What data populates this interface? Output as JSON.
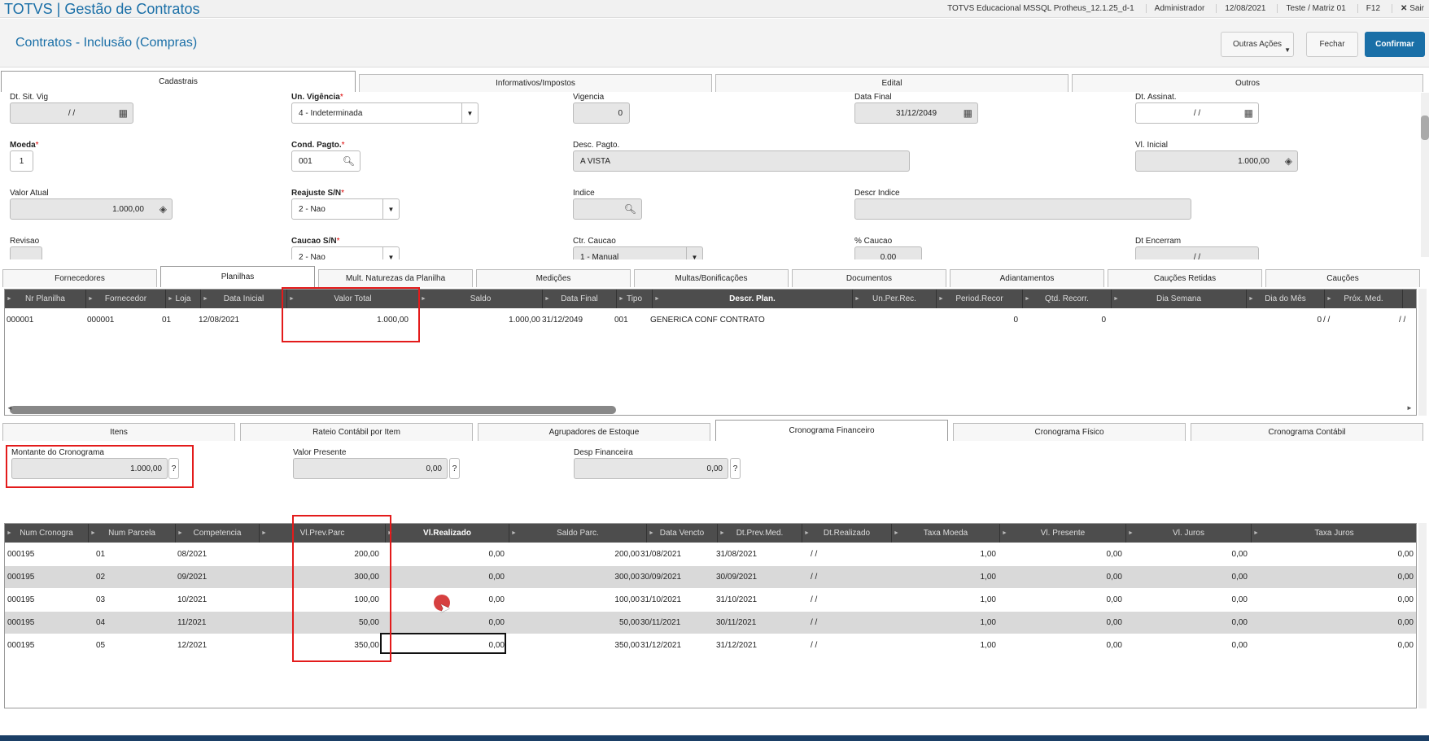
{
  "topbar": {
    "brand": "TOTVS | Gestão de Contratos",
    "env": "TOTVS Educacional MSSQL Protheus_12.1.25_d-1",
    "user": "Administrador",
    "date": "12/08/2021",
    "branch": "Teste / Matriz 01",
    "shortcut": "F12",
    "exit": "Sair"
  },
  "header": {
    "title": "Contratos - Inclusão (Compras)",
    "actions_label": "Outras Ações",
    "close_label": "Fechar",
    "confirm_label": "Confirmar"
  },
  "main_tabs": [
    "Cadastrais",
    "Informativos/Impostos",
    "Edital",
    "Outros"
  ],
  "form": {
    "dt_sit_vig": {
      "label": "Dt. Sit. Vig",
      "value": " / /"
    },
    "un_vigencia": {
      "label": "Un. Vigência",
      "value": "4 - Indeterminada"
    },
    "vigencia": {
      "label": "Vigencia",
      "value": "0"
    },
    "data_final": {
      "label": "Data Final",
      "value": "31/12/2049"
    },
    "dt_assinat": {
      "label": "Dt. Assinat.",
      "value": " / /"
    },
    "moeda": {
      "label": "Moeda",
      "value": "1"
    },
    "cond_pagto": {
      "label": "Cond. Pagto.",
      "value": "001"
    },
    "desc_pagto": {
      "label": "Desc. Pagto.",
      "value": "A VISTA"
    },
    "vl_inicial": {
      "label": "Vl. Inicial",
      "value": "1.000,00"
    },
    "valor_atual": {
      "label": "Valor Atual",
      "value": "1.000,00"
    },
    "reajuste": {
      "label": "Reajuste S/N",
      "value": "2 - Nao"
    },
    "indice": {
      "label": "Indice",
      "value": ""
    },
    "descr_indice": {
      "label": "Descr Indice",
      "value": ""
    },
    "revisao": {
      "label": "Revisao",
      "value": ""
    },
    "caucao": {
      "label": "Caucao S/N",
      "value": "2 - Nao"
    },
    "ctr_caucao": {
      "label": "Ctr. Caucao",
      "value": "1 - Manual"
    },
    "pct_caucao": {
      "label": "% Caucao",
      "value": "0,00"
    },
    "dt_encerram": {
      "label": "Dt Encerram",
      "value": " / /"
    }
  },
  "sub_tabs": [
    "Fornecedores",
    "Planilhas",
    "Mult. Naturezas da Planilha",
    "Medições",
    "Multas/Bonificações",
    "Documentos",
    "Adiantamentos",
    "Cauções Retidas",
    "Cauções"
  ],
  "planilhas_grid": {
    "columns": [
      "Nr Planilha",
      "Fornecedor",
      "Loja",
      "Data Inicial",
      "Valor Total",
      "Saldo",
      "Data Final",
      "Tipo",
      "Descr. Plan.",
      "Un.Per.Rec.",
      "Period.Recor",
      "Qtd. Recorr.",
      "Dia Semana",
      "Dia do Mês",
      "Próx. Med."
    ],
    "rows": [
      [
        "000001",
        "000001",
        "01",
        "12/08/2021",
        "1.000,00",
        "1.000,00",
        "31/12/2049",
        "001",
        "GENERICA CONF CONTRATO",
        "",
        "0",
        "0",
        "",
        "0",
        " / /",
        " / /"
      ]
    ]
  },
  "lower_tabs": [
    "Itens",
    "Rateio Contábil por Item",
    "Agrupadores de Estoque",
    "Cronograma Financeiro",
    "Cronograma Físico",
    "Cronograma Contábil"
  ],
  "cronograma": {
    "montante": {
      "label": "Montante do Cronograma",
      "value": "1.000,00"
    },
    "valor_presente": {
      "label": "Valor Presente",
      "value": "0,00"
    },
    "desp_financeira": {
      "label": "Desp Financeira",
      "value": "0,00"
    },
    "help": "?"
  },
  "cronograma_grid": {
    "columns": [
      "Num Cronogra",
      "Num Parcela",
      "Competencia",
      "Vl.Prev.Parc",
      "Vl.Realizado",
      "Saldo Parc.",
      "Data Vencto",
      "Dt.Prev.Med.",
      "Dt.Realizado",
      "Taxa Moeda",
      "Vl. Presente",
      "Vl. Juros",
      "Taxa Juros"
    ],
    "rows": [
      [
        "000195",
        "01",
        "08/2021",
        "200,00",
        "0,00",
        "200,00",
        "31/08/2021",
        "31/08/2021",
        " / /",
        "1,00",
        "0,00",
        "0,00",
        "0,00"
      ],
      [
        "000195",
        "02",
        "09/2021",
        "300,00",
        "0,00",
        "300,00",
        "30/09/2021",
        "30/09/2021",
        " / /",
        "1,00",
        "0,00",
        "0,00",
        "0,00"
      ],
      [
        "000195",
        "03",
        "10/2021",
        "100,00",
        "0,00",
        "100,00",
        "31/10/2021",
        "31/10/2021",
        " / /",
        "1,00",
        "0,00",
        "0,00",
        "0,00"
      ],
      [
        "000195",
        "04",
        "11/2021",
        "50,00",
        "0,00",
        "50,00",
        "30/11/2021",
        "30/11/2021",
        " / /",
        "1,00",
        "0,00",
        "0,00",
        "0,00"
      ],
      [
        "000195",
        "05",
        "12/2021",
        "350,00",
        "0,00",
        "350,00",
        "31/12/2021",
        "31/12/2021",
        " / /",
        "1,00",
        "0,00",
        "0,00",
        "0,00"
      ]
    ]
  },
  "colors": {
    "brand": "#1a6fa7",
    "header_bg": "#4d4d4d",
    "highlight": "#e31b1b"
  }
}
